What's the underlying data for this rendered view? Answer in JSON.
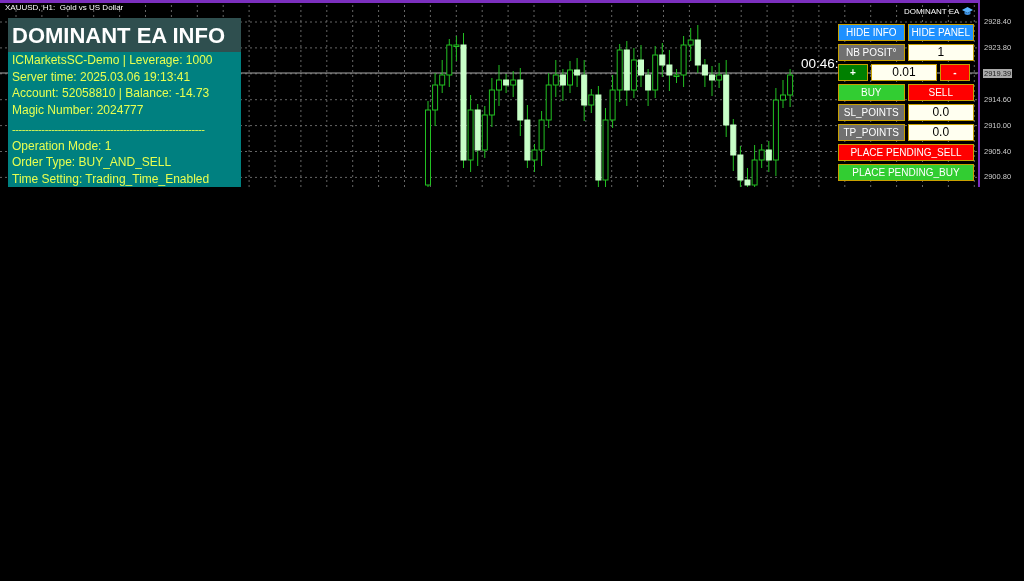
{
  "chart": {
    "title": "XAUUSD, H1:  Gold vs US Dollar",
    "ea_label": "DOMINANT EA",
    "timer": "00:46:",
    "price_axis": [
      {
        "label": "2928.40",
        "current": false
      },
      {
        "label": "2923.80",
        "current": false
      },
      {
        "label": "2919.39",
        "current": true
      },
      {
        "label": "2914.60",
        "current": false
      },
      {
        "label": "2910.00",
        "current": false
      },
      {
        "label": "2905.40",
        "current": false
      },
      {
        "label": "2900.80",
        "current": false
      }
    ]
  },
  "info_panel": {
    "title": "DOMINANT EA INFO",
    "lines": [
      {
        "kind": "text",
        "text": "ICMarketsSC-Demo | Leverage: 1000"
      },
      {
        "kind": "text",
        "text": "Server time: 2025.03.06 19:13:41"
      },
      {
        "kind": "text",
        "text": "Account: 52058810 | Balance: -14.73"
      },
      {
        "kind": "text",
        "text": "Magic Number: 2024777"
      },
      {
        "kind": "separator",
        "text": "-----------------------------------------------------------"
      },
      {
        "kind": "text",
        "text": "Operation Mode:  1"
      },
      {
        "kind": "text",
        "text": "Order Type: BUY_AND_SELL"
      },
      {
        "kind": "text",
        "text": "Time Setting: Trading_Time_Enabled"
      }
    ]
  },
  "controls": [
    [
      {
        "kind": "button",
        "label": "HIDE INFO",
        "color": "#1e90ff"
      },
      {
        "kind": "button",
        "label": "HIDE PANEL",
        "color": "#1e90ff"
      }
    ],
    [
      {
        "kind": "button",
        "label": "NB POSIT°",
        "color": "#707070"
      },
      {
        "kind": "field",
        "value": "1"
      }
    ],
    [
      {
        "kind": "small",
        "label": "+",
        "color": "#008000"
      },
      {
        "kind": "field",
        "value": "0.01"
      },
      {
        "kind": "small",
        "label": "-",
        "color": "#ff0000"
      }
    ],
    [
      {
        "kind": "button",
        "label": "BUY",
        "color": "#32cd32"
      },
      {
        "kind": "button",
        "label": "SELL",
        "color": "#ff0000"
      }
    ],
    [
      {
        "kind": "button",
        "label": "SL_POINTS",
        "color": "#707070"
      },
      {
        "kind": "field",
        "value": "0.0"
      }
    ],
    [
      {
        "kind": "button",
        "label": "TP_POINTS",
        "color": "#707070"
      },
      {
        "kind": "field",
        "value": "0.0"
      }
    ],
    [
      {
        "kind": "wide",
        "label": "PLACE PENDING_SELL",
        "color": "#ff0000"
      }
    ],
    [
      {
        "kind": "wide",
        "label": "PLACE PENDING_BUY",
        "color": "#32cd32"
      }
    ]
  ]
}
